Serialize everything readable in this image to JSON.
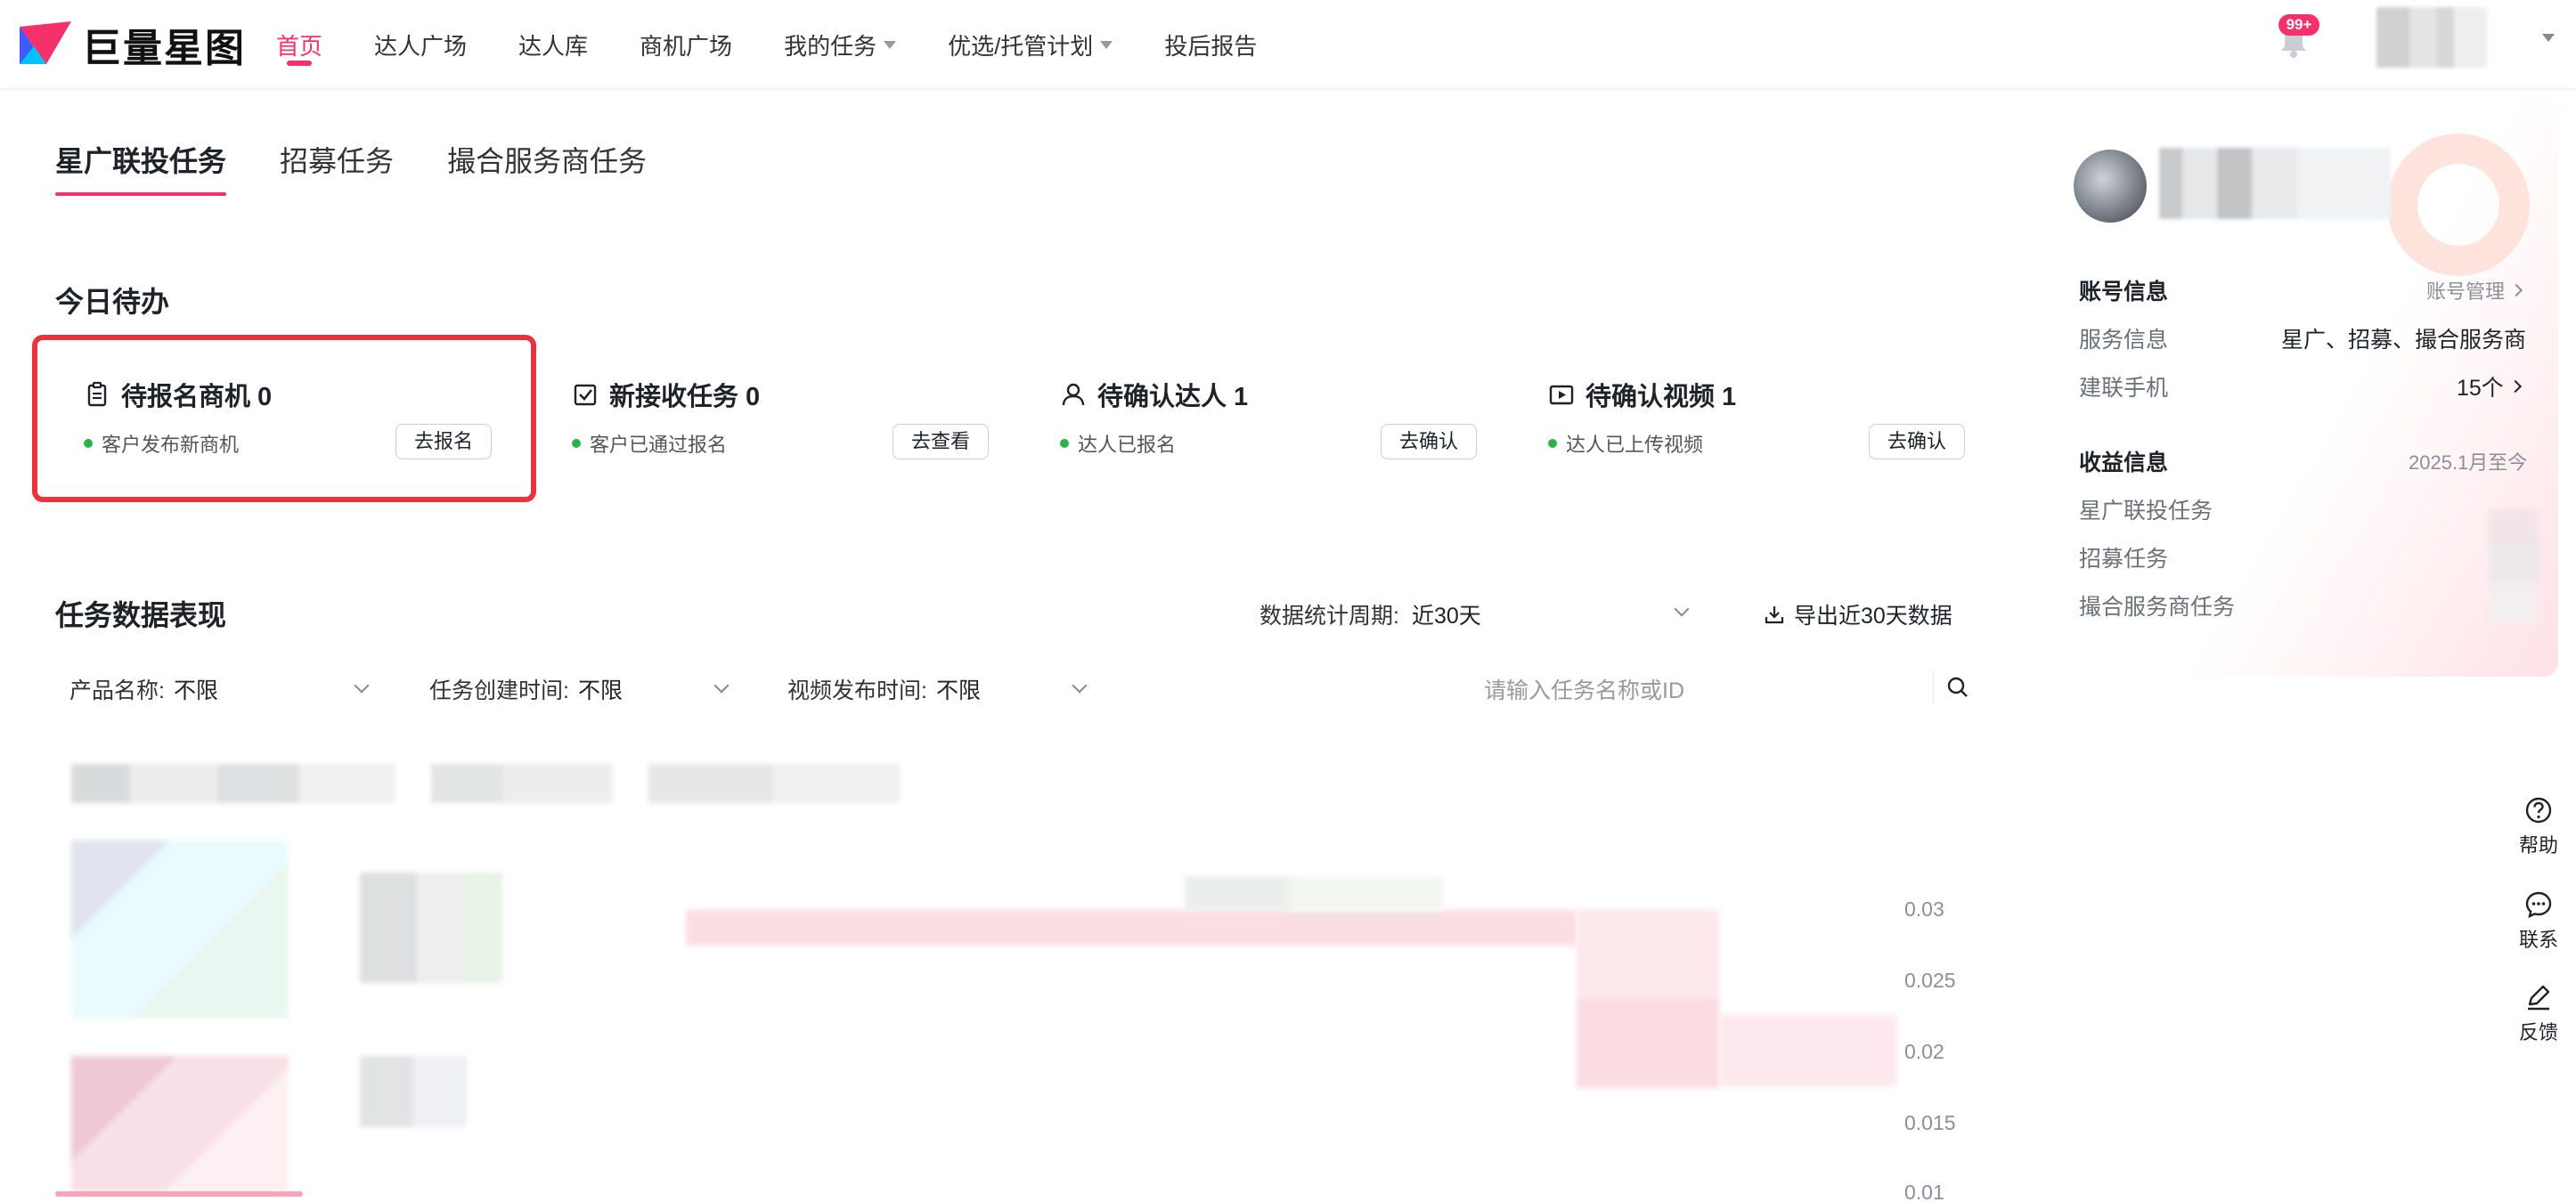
{
  "brand": {
    "logo_text": "巨量星图"
  },
  "nav": {
    "items": [
      {
        "label": "首页",
        "active": true,
        "dropdown": false
      },
      {
        "label": "达人广场",
        "active": false,
        "dropdown": false
      },
      {
        "label": "达人库",
        "active": false,
        "dropdown": false
      },
      {
        "label": "商机广场",
        "active": false,
        "dropdown": false
      },
      {
        "label": "我的任务",
        "active": false,
        "dropdown": true
      },
      {
        "label": "优选/托管计划",
        "active": false,
        "dropdown": true
      },
      {
        "label": "投后报告",
        "active": false,
        "dropdown": false
      }
    ],
    "notification_badge": "99+"
  },
  "tabs": [
    "星广联投任务",
    "招募任务",
    "撮合服务商任务"
  ],
  "todo": {
    "title": "今日待办",
    "cards": [
      {
        "title": "待报名商机 0",
        "status": "客户发布新商机",
        "button": "去报名",
        "icon": "clipboard-icon",
        "highlighted": true
      },
      {
        "title": "新接收任务 0",
        "status": "客户已通过报名",
        "button": "去查看",
        "icon": "check-square-icon",
        "highlighted": false
      },
      {
        "title": "待确认达人 1",
        "status": "达人已报名",
        "button": "去确认",
        "icon": "user-icon",
        "highlighted": false
      },
      {
        "title": "待确认视频 1",
        "status": "达人已上传视频",
        "button": "去确认",
        "icon": "video-icon",
        "highlighted": false
      }
    ]
  },
  "performance": {
    "title": "任务数据表现",
    "period_label": "数据统计周期:",
    "period_value": "近30天",
    "export_label": "导出近30天数据",
    "filters": [
      {
        "label": "产品名称:",
        "value": "不限"
      },
      {
        "label": "任务创建时间:",
        "value": "不限"
      },
      {
        "label": "视频发布时间:",
        "value": "不限"
      }
    ],
    "search_placeholder": "请输入任务名称或ID",
    "axis_ticks": [
      "0.03",
      "0.025",
      "0.02",
      "0.015",
      "0.01"
    ]
  },
  "account": {
    "title": "账号信息",
    "manage_link": "账号管理",
    "service_label": "服务信息",
    "service_value": "星广、招募、撮合服务商",
    "phone_label": "建联手机",
    "phone_value": "15个"
  },
  "income": {
    "title": "收益信息",
    "period": "2025.1月至今",
    "items": [
      "星广联投任务",
      "招募任务",
      "撮合服务商任务"
    ]
  },
  "tools": [
    {
      "label": "帮助",
      "icon": "help-icon"
    },
    {
      "label": "联系",
      "icon": "chat-icon"
    },
    {
      "label": "反馈",
      "icon": "edit-icon"
    }
  ],
  "colors": {
    "brand": "#f5316b",
    "highlight": "#e8323c",
    "status_green": "#2bb34a"
  }
}
